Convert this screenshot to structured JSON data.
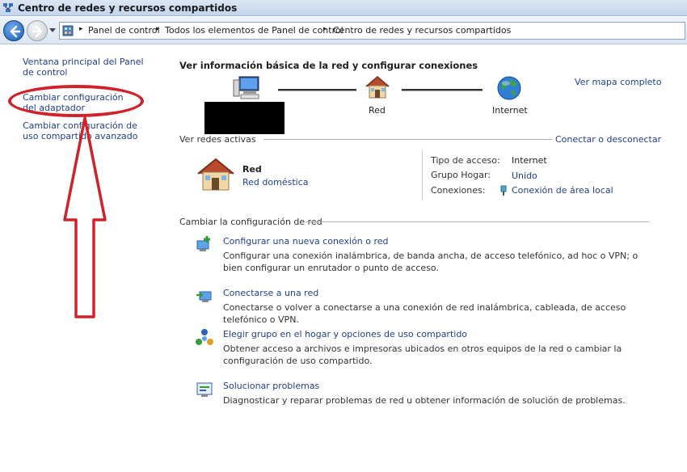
{
  "window": {
    "title": "Centro de redes y recursos compartidos"
  },
  "address": {
    "crumbs": [
      "Panel de control",
      "Todos los elementos de Panel de control",
      "Centro de redes y recursos compartidos"
    ]
  },
  "left": {
    "links": [
      {
        "text": "Ventana principal del Panel de control"
      },
      {
        "text": "Cambiar configuración del adaptador"
      },
      {
        "text": "Cambiar configuración de uso compartido avanzado"
      }
    ]
  },
  "main": {
    "heading": "Ver información básica de la red y configurar conexiones",
    "view_full_map": "Ver mapa completo",
    "map": {
      "network_label": "Red",
      "internet_label": "Internet"
    },
    "active_networks": {
      "title": "Ver redes activas",
      "connect_link": "Conectar o desconectar",
      "network_name": "Red",
      "network_type": "Red doméstica",
      "access_type_label": "Tipo de acceso:",
      "access_type_value": "Internet",
      "homegroup_label": "Grupo Hogar:",
      "homegroup_value": "Unido",
      "connections_label": "Conexiones:",
      "connections_value": "Conexión de área local"
    },
    "change_settings": {
      "title": "Cambiar la configuración de red",
      "items": [
        {
          "title": "Configurar una nueva conexión o red",
          "desc": "Configurar una conexión inalámbrica, de banda ancha, de acceso telefónico, ad hoc o VPN; o bien configurar un enrutador o punto de acceso."
        },
        {
          "title": "Conectarse a una red",
          "desc": "Conectarse o volver a conectarse a una conexión de red inalámbrica, cableada, de acceso telefónico o VPN."
        },
        {
          "title": "Elegir grupo en el hogar y opciones de uso compartido",
          "desc": "Obtener acceso a archivos e impresoras ubicados en otros equipos de la red o cambiar la configuración de uso compartido."
        },
        {
          "title": "Solucionar problemas",
          "desc": "Diagnosticar y reparar problemas de red u obtener información de solución de problemas."
        }
      ]
    }
  },
  "colors": {
    "link": "#1f3f8f",
    "annotation": "#d0222a",
    "titlebar": "#c3d5ec"
  }
}
